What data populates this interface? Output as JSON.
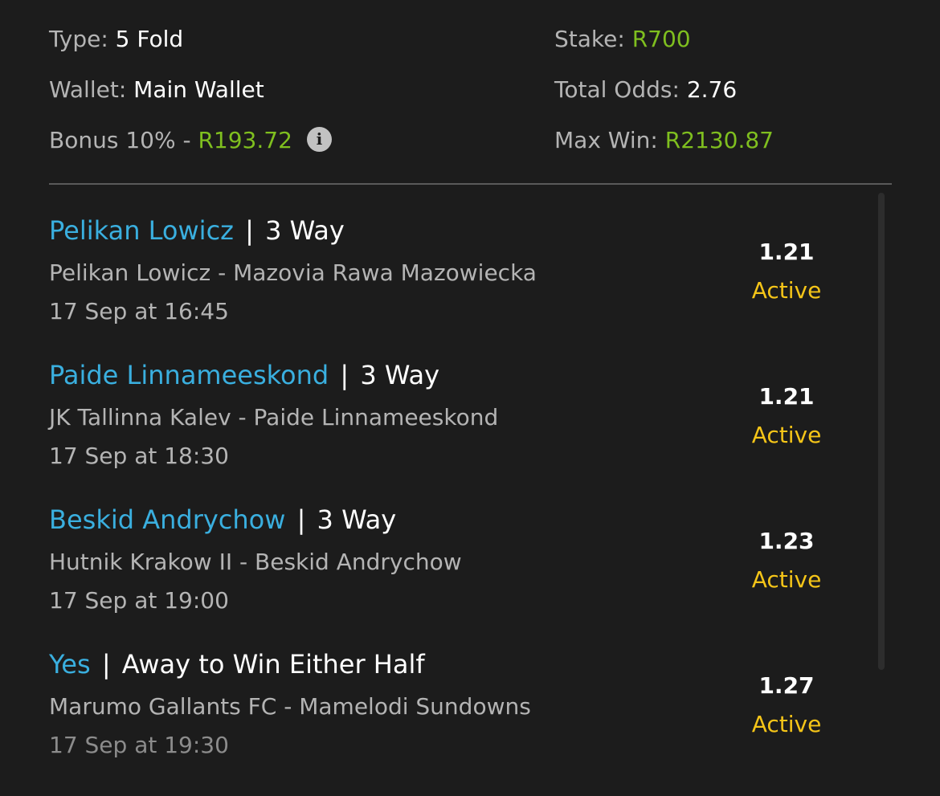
{
  "summary": {
    "type_label": "Type:",
    "type_value": "5 Fold",
    "wallet_label": "Wallet:",
    "wallet_value": "Main Wallet",
    "bonus_label": "Bonus 10% -",
    "bonus_value": "R193.72",
    "info_icon": "info-icon",
    "stake_label": "Stake:",
    "stake_value": "R700",
    "total_odds_label": "Total Odds:",
    "total_odds_value": "2.76",
    "max_win_label": "Max Win:",
    "max_win_value": "R2130.87"
  },
  "legs": [
    {
      "selection": "Pelikan Lowicz",
      "separator": "|",
      "market": "3 Way",
      "match": "Pelikan Lowicz - Mazovia Rawa Mazowiecka",
      "date": "17 Sep at 16:45",
      "odds": "1.21",
      "status": "Active"
    },
    {
      "selection": "Paide Linnameeskond",
      "separator": "|",
      "market": "3 Way",
      "match": "JK Tallinna Kalev - Paide Linnameeskond",
      "date": "17 Sep at 18:30",
      "odds": "1.21",
      "status": "Active"
    },
    {
      "selection": "Beskid Andrychow",
      "separator": "|",
      "market": "3 Way",
      "match": "Hutnik Krakow II - Beskid Andrychow",
      "date": "17 Sep at 19:00",
      "odds": "1.23",
      "status": "Active"
    },
    {
      "selection": "Yes",
      "separator": "|",
      "market": "Away to Win Either Half",
      "match": "Marumo Gallants FC - Mamelodi Sundowns",
      "date": "17 Sep at 19:30",
      "odds": "1.27",
      "status": "Active"
    }
  ],
  "colors": {
    "background": "#1c1c1c",
    "label_gray": "#b4b4b4",
    "money_green": "#7fbf1f",
    "selection_blue": "#3aafdf",
    "status_yellow": "#f5c518"
  }
}
